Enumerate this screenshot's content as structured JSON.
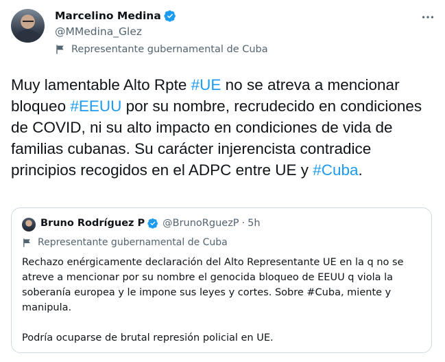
{
  "author": {
    "name": "Marcelino Medina",
    "handle": "@MMedina_Glez",
    "label": "Representante gubernamental de Cuba",
    "verified_icon": "verified-badge-icon",
    "more_icon": "more-options-icon"
  },
  "tweet": {
    "t1": "Muy lamentable Alto Rpte ",
    "h1": "#UE",
    "t2": " no se atreva a mencionar bloqueo ",
    "h2": "#EEUU",
    "t3": " por su nombre, recrudecido en condiciones de COVID, ni su alto impacto en condiciones de vida de familias cubanas. Su carácter injerencista contradice principios recogidos en el ADPC entre UE y ",
    "h3": "#Cuba",
    "t4": "."
  },
  "quoted": {
    "name": "Bruno Rodríguez P",
    "handle": "@BrunoRguezP",
    "separator": "·",
    "time": "5h",
    "label": "Representante gubernamental de Cuba",
    "paragraph1": "Rechazo enérgicamente declaración del Alto Representante UE en la q no se atreve a mencionar por su nombre el genocida bloqueo de EEUU q viola la soberanía europea y le impone sus leyes y cortes. Sobre #Cuba, miente y manipula.",
    "paragraph2": "Podría ocuparse de brutal represión policial en UE."
  },
  "colors": {
    "link": "#1d9bf0",
    "secondary_text": "#536471",
    "border": "#cfd9de"
  }
}
